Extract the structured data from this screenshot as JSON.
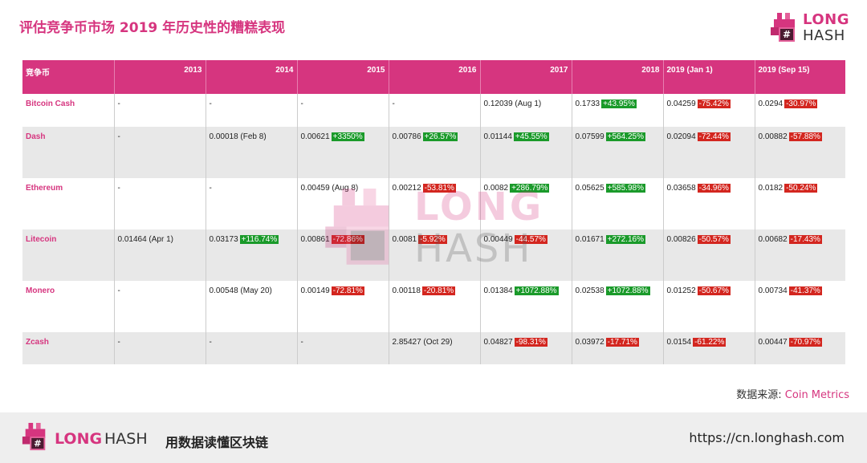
{
  "title": "评估竞争币市场 2019 年历史性的糟糕表现",
  "logo": {
    "line1": "LONG",
    "line2": "HASH"
  },
  "brand_color": "#d6357f",
  "positive_color": "#1a9a2a",
  "negative_color": "#d3261f",
  "table": {
    "headers": [
      "竞争币",
      "2013",
      "2014",
      "2015",
      "2016",
      "2017",
      "2018",
      "2019 (Jan 1)",
      "2019 (Sep 15)"
    ],
    "rows": [
      {
        "name": "Bitcoin Cash",
        "cells": [
          {
            "value": "-",
            "change": "",
            "dir": ""
          },
          {
            "value": "-",
            "change": "",
            "dir": ""
          },
          {
            "value": "-",
            "change": "",
            "dir": ""
          },
          {
            "value": "-",
            "change": "",
            "dir": ""
          },
          {
            "value": "0.12039 (Aug 1)",
            "change": "",
            "dir": ""
          },
          {
            "value": "0.1733",
            "change": "+43.95%",
            "dir": "pos"
          },
          {
            "value": "0.04259",
            "change": "-75.42%",
            "dir": "neg"
          },
          {
            "value": "0.0294",
            "change": "-30.97%",
            "dir": "neg"
          }
        ]
      },
      {
        "name": "Dash",
        "cells": [
          {
            "value": "-",
            "change": "",
            "dir": ""
          },
          {
            "value": "0.00018 (Feb 8)",
            "change": "",
            "dir": ""
          },
          {
            "value": "0.00621",
            "change": "+3350%",
            "dir": "pos"
          },
          {
            "value": "0.00786",
            "change": "+26.57%",
            "dir": "pos"
          },
          {
            "value": "0.01144",
            "change": "+45.55%",
            "dir": "pos"
          },
          {
            "value": "0.07599",
            "change": "+564.25%",
            "dir": "pos"
          },
          {
            "value": "0.02094",
            "change": "-72.44%",
            "dir": "neg"
          },
          {
            "value": "0.00882",
            "change": "-57.88%",
            "dir": "neg"
          }
        ]
      },
      {
        "name": "Ethereum",
        "cells": [
          {
            "value": "-",
            "change": "",
            "dir": ""
          },
          {
            "value": "-",
            "change": "",
            "dir": ""
          },
          {
            "value": "0.00459 (Aug 8)",
            "change": "",
            "dir": ""
          },
          {
            "value": "0.00212",
            "change": "-53.81%",
            "dir": "neg"
          },
          {
            "value": "0.0082",
            "change": "+286.79%",
            "dir": "pos"
          },
          {
            "value": "0.05625",
            "change": "+585.98%",
            "dir": "pos"
          },
          {
            "value": "0.03658",
            "change": "-34.96%",
            "dir": "neg"
          },
          {
            "value": "0.0182",
            "change": "-50.24%",
            "dir": "neg"
          }
        ]
      },
      {
        "name": "Litecoin",
        "cells": [
          {
            "value": "0.01464 (Apr 1)",
            "change": "",
            "dir": ""
          },
          {
            "value": "0.03173",
            "change": "+116.74%",
            "dir": "pos"
          },
          {
            "value": "0.00861",
            "change": "-72.86%",
            "dir": "neg"
          },
          {
            "value": "0.0081",
            "change": "-5.92%",
            "dir": "neg"
          },
          {
            "value": "0.00449",
            "change": "-44.57%",
            "dir": "neg"
          },
          {
            "value": "0.01671",
            "change": "+272.16%",
            "dir": "pos"
          },
          {
            "value": "0.00826",
            "change": "-50.57%",
            "dir": "neg"
          },
          {
            "value": "0.00682",
            "change": "-17.43%",
            "dir": "neg"
          }
        ]
      },
      {
        "name": "Monero",
        "cells": [
          {
            "value": "-",
            "change": "",
            "dir": ""
          },
          {
            "value": "0.00548 (May 20)",
            "change": "",
            "dir": ""
          },
          {
            "value": "0.00149",
            "change": "-72.81%",
            "dir": "neg"
          },
          {
            "value": "0.00118",
            "change": "-20.81%",
            "dir": "neg"
          },
          {
            "value": "0.01384",
            "change": "+1072.88%",
            "dir": "pos"
          },
          {
            "value": "0.02538",
            "change": "+1072.88%",
            "dir": "pos"
          },
          {
            "value": "0.01252",
            "change": "-50.67%",
            "dir": "neg"
          },
          {
            "value": "0.00734",
            "change": "-41.37%",
            "dir": "neg"
          }
        ]
      },
      {
        "name": "Zcash",
        "cells": [
          {
            "value": "-",
            "change": "",
            "dir": ""
          },
          {
            "value": "-",
            "change": "",
            "dir": ""
          },
          {
            "value": "-",
            "change": "",
            "dir": ""
          },
          {
            "value": "2.85427 (Oct 29)",
            "change": "",
            "dir": ""
          },
          {
            "value": "0.04827",
            "change": "-98.31%",
            "dir": "neg"
          },
          {
            "value": "0.03972",
            "change": "-17.71%",
            "dir": "neg"
          },
          {
            "value": "0.0154",
            "change": "-61.22%",
            "dir": "neg"
          },
          {
            "value": "0.00447",
            "change": "-70.97%",
            "dir": "neg"
          }
        ]
      }
    ]
  },
  "source": {
    "label": "数据来源: ",
    "name": "Coin Metrics"
  },
  "footer": {
    "brand1": "LONG",
    "brand2": "HASH",
    "slogan": "用数据读懂区块链",
    "url": "https://cn.longhash.com"
  }
}
